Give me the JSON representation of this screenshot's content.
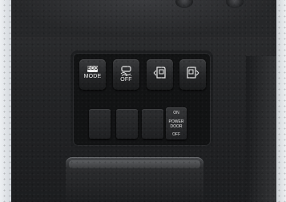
{
  "controls": {
    "eco_mode": {
      "badge": "ECO",
      "label": "MODE",
      "icon": "eco-leaf"
    },
    "vdc_off": {
      "label": "OFF",
      "icon": "skidding-car-icon"
    },
    "sliding_door_left": {
      "icon": "left-sliding-door-icon"
    },
    "sliding_door_right": {
      "icon": "right-sliding-door-icon"
    },
    "power_door": {
      "on_label": "ON",
      "title_line1": "POWER",
      "title_line2": "DOOR",
      "off_label": "OFF"
    }
  },
  "colors": {
    "panel": "#121314",
    "button": "#2a2b2d",
    "label": "#f0f0f0"
  }
}
